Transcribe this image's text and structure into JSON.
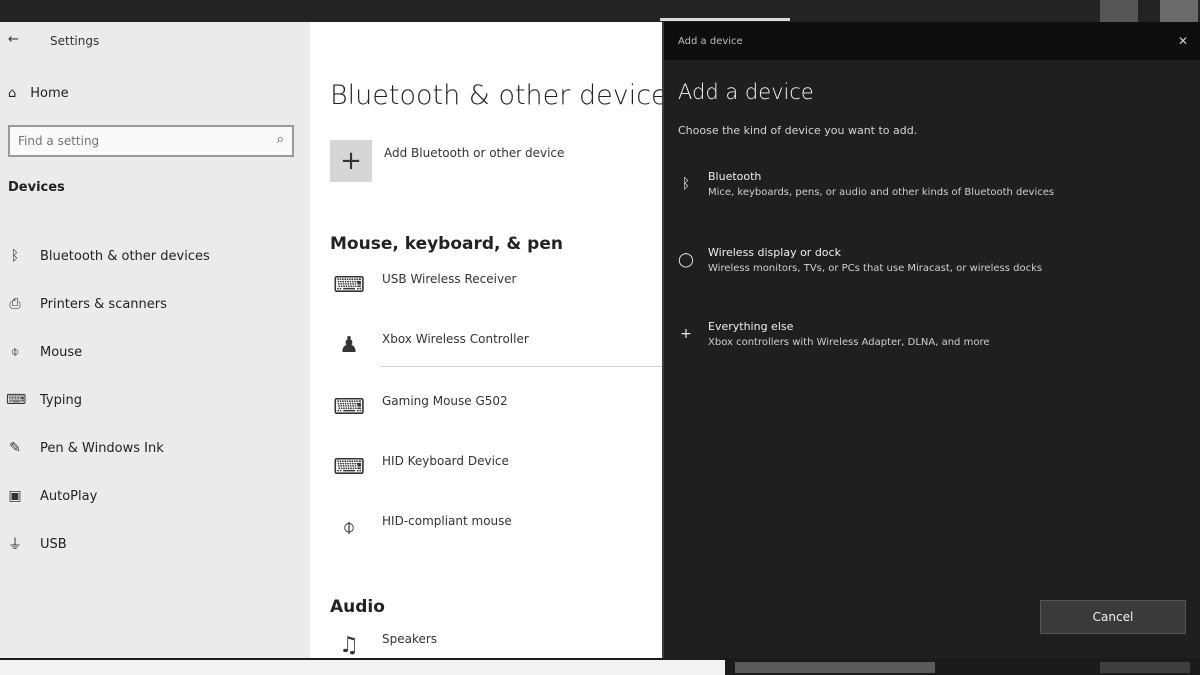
{
  "settings": {
    "app_title": "Settings",
    "back_icon": "back-arrow-icon",
    "home": {
      "label": "Home",
      "icon": "home-icon"
    },
    "search": {
      "placeholder": "Find a setting",
      "icon": "search-icon"
    },
    "section": "Devices",
    "nav": [
      {
        "label": "Bluetooth & other devices",
        "icon": "bluetooth-icon"
      },
      {
        "label": "Printers & scanners",
        "icon": "printer-icon"
      },
      {
        "label": "Mouse",
        "icon": "mouse-icon"
      },
      {
        "label": "Typing",
        "icon": "keyboard-icon"
      },
      {
        "label": "Pen & Windows Ink",
        "icon": "pen-icon"
      },
      {
        "label": "AutoPlay",
        "icon": "autoplay-icon"
      },
      {
        "label": "USB",
        "icon": "usb-icon"
      }
    ],
    "page_title": "Bluetooth & other devices",
    "add_device_label": "Add Bluetooth or other device",
    "mouse_heading": "Mouse, keyboard, & pen",
    "devices": [
      {
        "name": "USB Wireless Receiver",
        "icon": "keyboard-icon"
      },
      {
        "name": "Xbox Wireless Controller",
        "icon": "headset-icon"
      },
      {
        "name": "Gaming Mouse G502",
        "icon": "keyboard-icon"
      },
      {
        "name": "HID Keyboard Device",
        "icon": "keyboard-icon"
      },
      {
        "name": "HID-compliant mouse",
        "icon": "mouse-icon"
      }
    ],
    "audio_heading": "Audio",
    "audio_devices": [
      {
        "name": "Speakers",
        "icon": "headphones-icon"
      }
    ]
  },
  "dialog": {
    "window_title": "Add a device",
    "title": "Add a device",
    "instruction": "Choose the kind of device you want to add.",
    "options": [
      {
        "title": "Bluetooth",
        "desc": "Mice, keyboards, pens, or audio and other kinds of Bluetooth devices",
        "icon": "bluetooth-icon"
      },
      {
        "title": "Wireless display or dock",
        "desc": "Wireless monitors, TVs, or PCs that use Miracast, or wireless docks",
        "icon": "display-icon"
      },
      {
        "title": "Everything else",
        "desc": "Xbox controllers with Wireless Adapter, DLNA, and more",
        "icon": "plus-icon"
      }
    ],
    "cancel_label": "Cancel",
    "close_icon": "close-icon"
  }
}
